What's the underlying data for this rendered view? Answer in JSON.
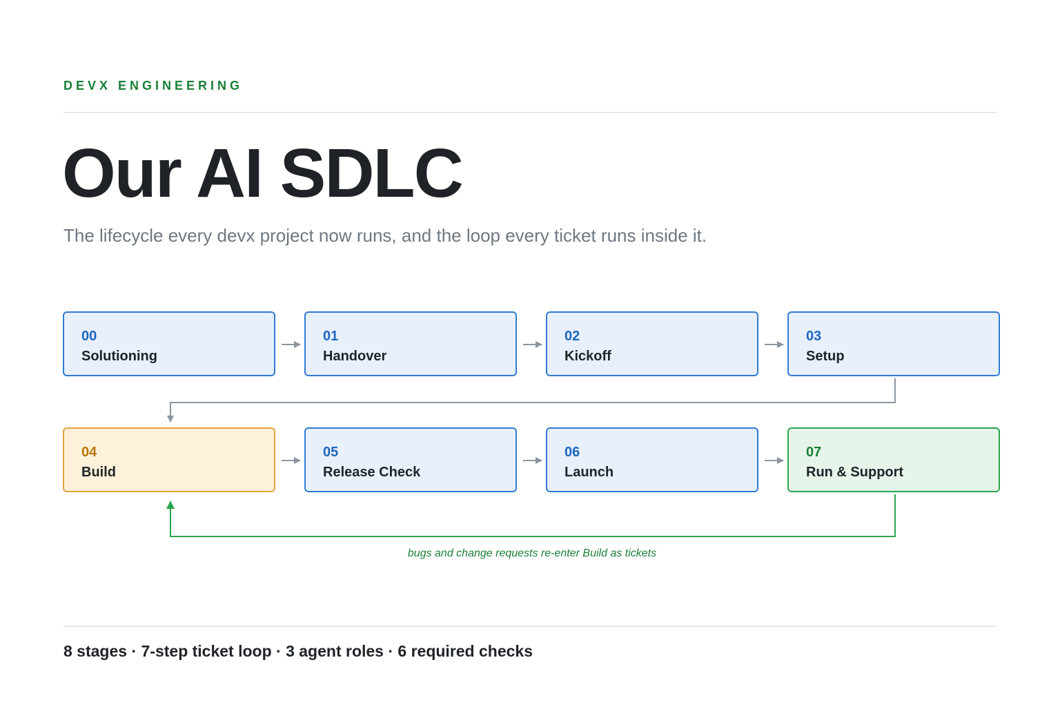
{
  "header": {
    "eyebrow": "DEVX ENGINEERING",
    "title": "Our AI SDLC",
    "subtitle": "The lifecycle every devx project now runs, and the loop every ticket runs inside it."
  },
  "stages": [
    {
      "number": "00",
      "name": "Solutioning"
    },
    {
      "number": "01",
      "name": "Handover"
    },
    {
      "number": "02",
      "name": "Kickoff"
    },
    {
      "number": "03",
      "name": "Setup"
    },
    {
      "number": "04",
      "name": "Build"
    },
    {
      "number": "05",
      "name": "Release Check"
    },
    {
      "number": "06",
      "name": "Launch"
    },
    {
      "number": "07",
      "name": "Run & Support"
    }
  ],
  "loop": {
    "note": "bugs and change requests re-enter Build as tickets"
  },
  "footer": {
    "summary": "8 stages · 7-step ticket loop · 3 agent roles · 6 required checks"
  },
  "colors": {
    "accent_green": "#1a7f37",
    "stage_blue": "#2f7bd1",
    "build_orange": "#e6a23c",
    "run_green": "#2da44e",
    "connector_gray": "#8c959f"
  }
}
